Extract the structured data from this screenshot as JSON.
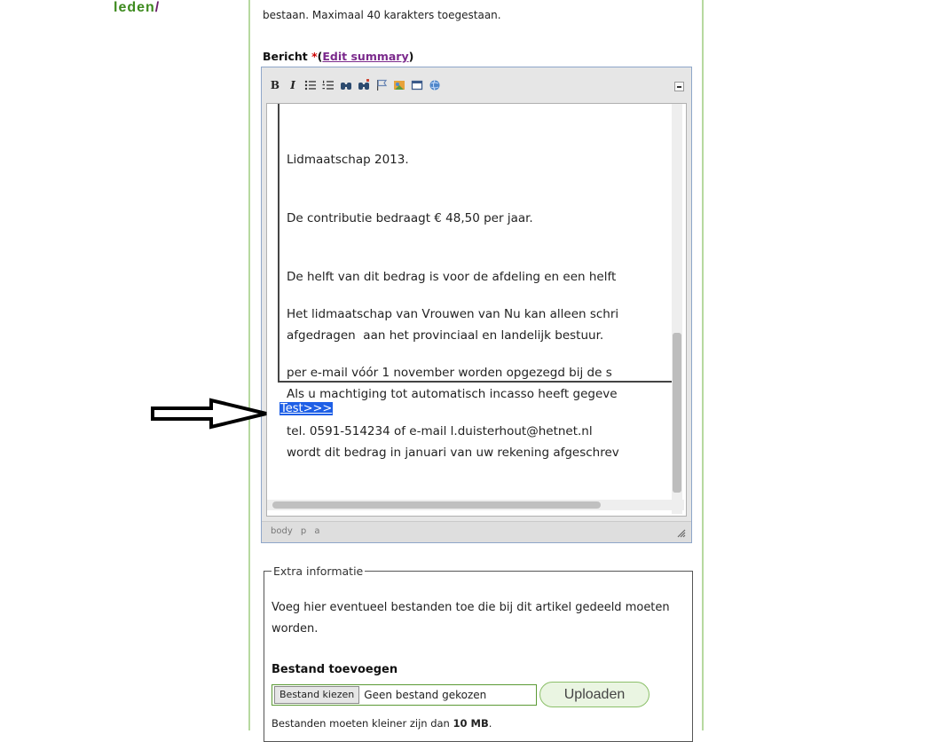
{
  "sidebar": {
    "logo_text": "leden",
    "logo_slash": "/"
  },
  "form": {
    "title_note": "bestaan. Maximaal 40 karakters toegestaan.",
    "message_label": "Bericht",
    "required_marker": "*",
    "edit_summary_open": "(",
    "edit_summary_link": "Edit summary",
    "edit_summary_close": ")"
  },
  "editor": {
    "toolbar": {
      "bold_label": "B",
      "italic_label": "I",
      "icons": [
        "bullet-list-icon",
        "numbered-list-icon",
        "binoculars-icon",
        "binoculars-replace-icon",
        "flag-icon",
        "image-icon",
        "table-icon",
        "globe-link-icon"
      ]
    },
    "content": {
      "paragraph1": [
        "Lidmaatschap 2013.",
        "De contributie bedraagt € 48,50 per jaar.",
        "De helft van dit bedrag is voor de afdeling en een helft",
        "afgedragen  aan het provinciaal en landelijk bestuur.",
        "Als u machtiging tot automatisch incasso heeft gegeve",
        "wordt dit bedrag in januari van uw rekening afgeschrev"
      ],
      "paragraph2": [
        "Het lidmaatschap van Vrouwen van Nu kan alleen schri",
        "per e-mail vóór 1 november worden opgezegd bij de s",
        "tel. 0591-514234 of e-mail l.duisterhout@hetnet.nl"
      ],
      "selected_link": "Test>>>"
    },
    "status_path": "body p a"
  },
  "extra": {
    "legend": "Extra informatie",
    "description": "Voeg hier eventueel bestanden toe die bij dit artikel gedeeld moeten worden.",
    "upload_heading": "Bestand toevoegen",
    "choose_button": "Bestand kiezen",
    "no_file": "Geen bestand gekozen",
    "upload_button": "Uploaden",
    "size_note_prefix": "Bestanden moeten kleiner zijn dan ",
    "size_note_value": "10 MB",
    "size_note_suffix": "."
  }
}
